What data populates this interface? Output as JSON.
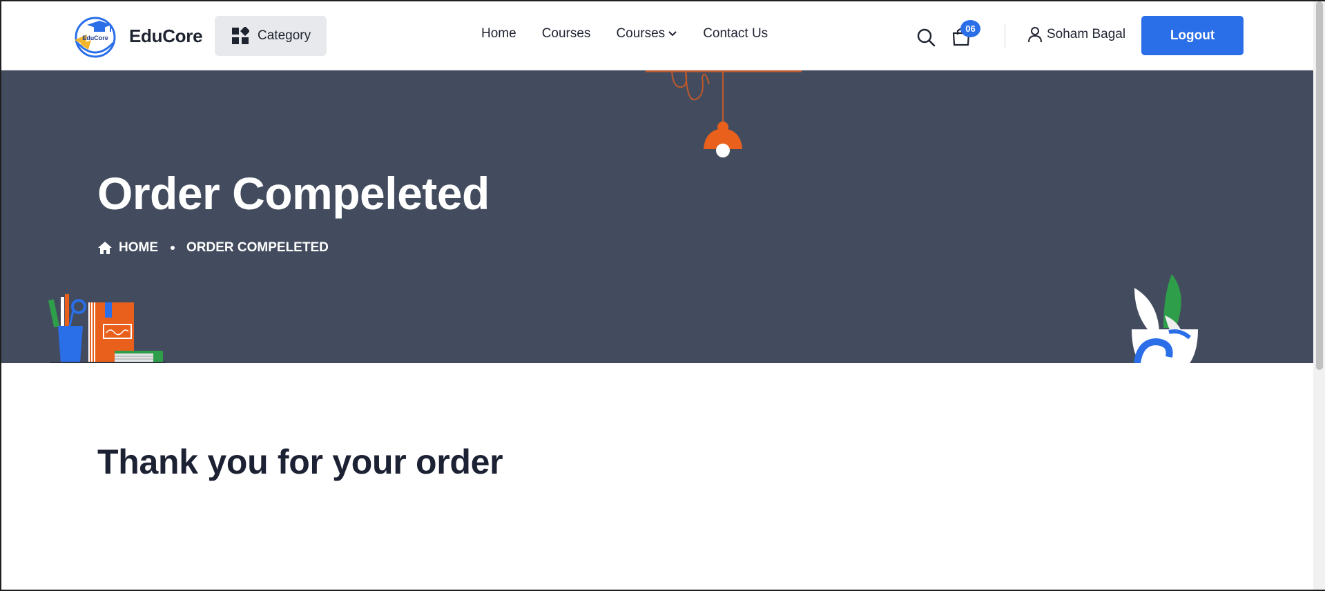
{
  "header": {
    "brand": "EduCore",
    "logo_text": "EduCore",
    "category_label": "Category",
    "nav": [
      {
        "label": "Home"
      },
      {
        "label": "Courses"
      },
      {
        "label": "Courses",
        "has_dropdown": true
      },
      {
        "label": "Contact Us"
      }
    ],
    "cart_count": "06",
    "user_name": "Soham Bagal",
    "logout_label": "Logout"
  },
  "hero": {
    "title": "Order Compeleted",
    "breadcrumb": {
      "home": "HOME",
      "current": "ORDER COMPELETED"
    }
  },
  "main": {
    "heading": "Thank you for your order"
  },
  "colors": {
    "primary": "#2a6ee8",
    "hero_bg": "#434c5e",
    "text_dark": "#1c2233",
    "lamp_orange": "#e8601c"
  }
}
